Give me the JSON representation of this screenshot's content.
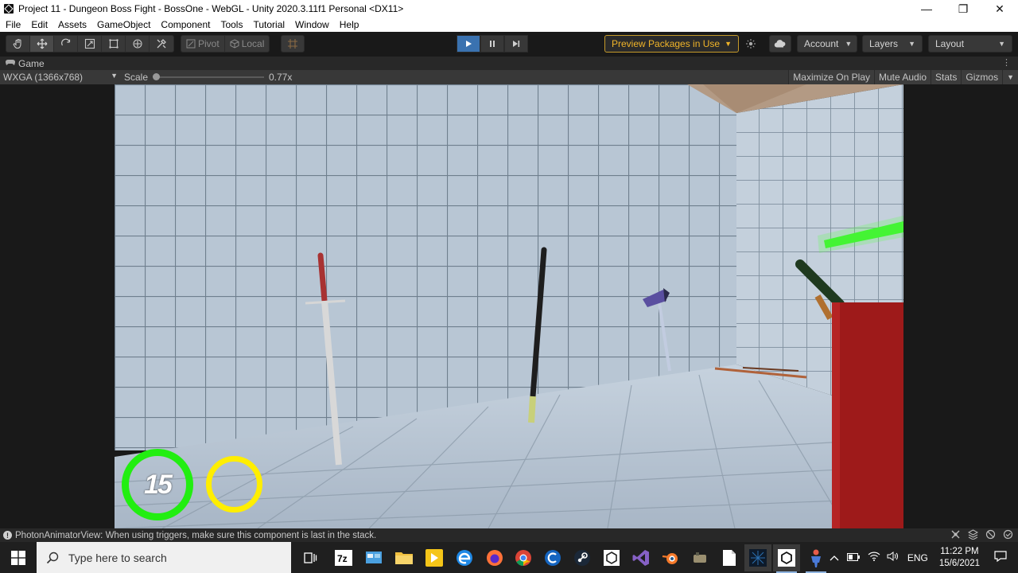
{
  "window": {
    "title": "Project 11 - Dungeon Boss Fight - BossOne - WebGL - Unity 2020.3.11f1 Personal <DX11>",
    "minimize": "—",
    "maximize": "❐",
    "close": "✕"
  },
  "menu": [
    "File",
    "Edit",
    "Assets",
    "GameObject",
    "Component",
    "Tools",
    "Tutorial",
    "Window",
    "Help"
  ],
  "toolbar": {
    "pivot_label": "Pivot",
    "local_label": "Local",
    "preview_packages": "Preview Packages in Use",
    "account": "Account",
    "layers": "Layers",
    "layout": "Layout"
  },
  "game_view": {
    "tab_label": "Game",
    "resolution": "WXGA (1366x768)",
    "scale_label": "Scale",
    "scale_value": "0.77x",
    "maximize_on_play": "Maximize On Play",
    "mute_audio": "Mute Audio",
    "stats": "Stats",
    "gizmos": "Gizmos"
  },
  "hud": {
    "counter": "15",
    "health_ring_color": "#22ee11",
    "secondary_ring_color": "#ffee00"
  },
  "status": {
    "message": "PhotonAnimatorView: When using triggers, make sure this component is last in the stack."
  },
  "taskbar": {
    "search_placeholder": "Type here to search",
    "language": "ENG",
    "time": "11:22 PM",
    "date": "15/6/2021"
  }
}
